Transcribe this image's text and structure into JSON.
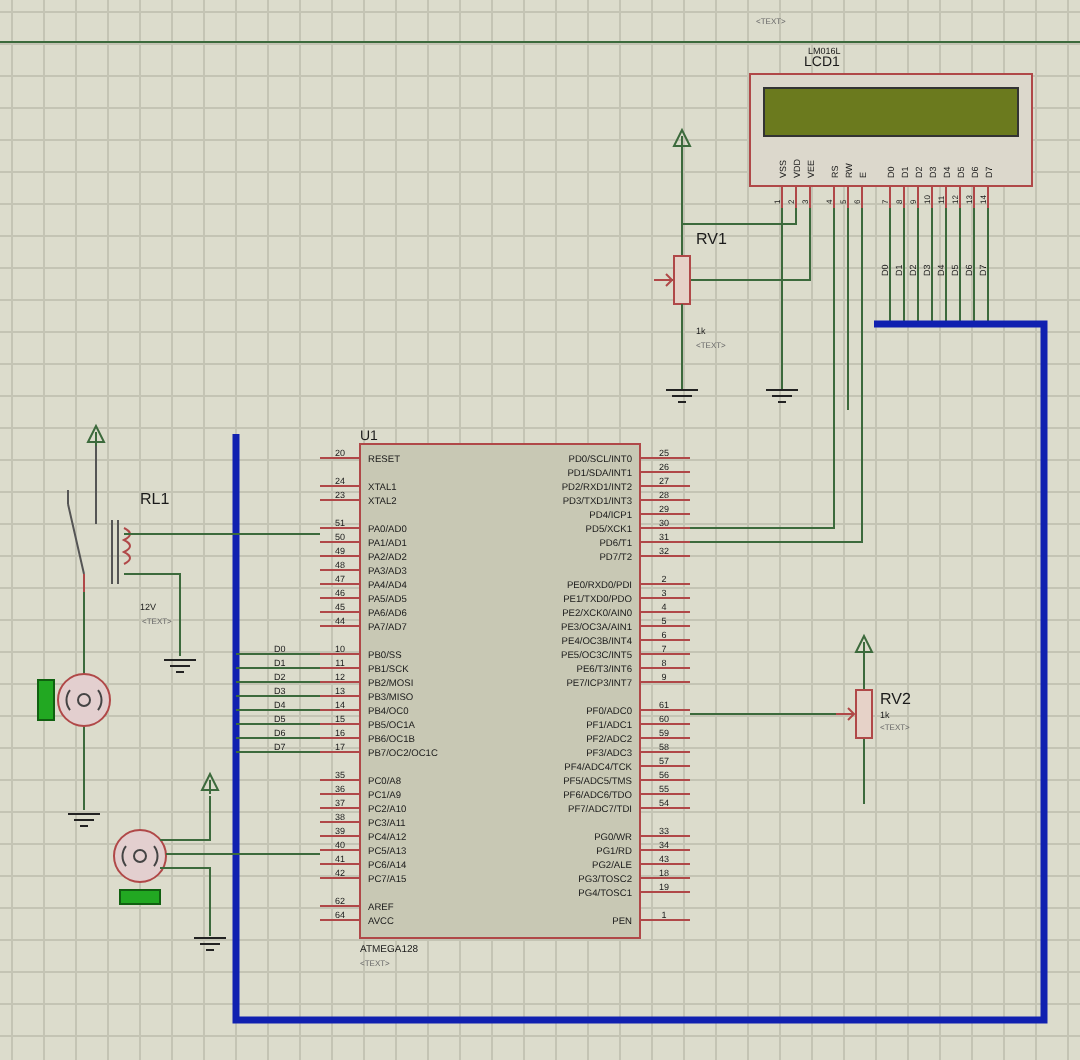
{
  "lcd": {
    "ref": "LCD1",
    "part": "LM016L",
    "text": "<TEXT>",
    "pins": [
      {
        "name": "VSS",
        "number": "1"
      },
      {
        "name": "VDD",
        "number": "2"
      },
      {
        "name": "VEE",
        "number": "3"
      },
      {
        "name": "RS",
        "number": "4"
      },
      {
        "name": "RW",
        "number": "5"
      },
      {
        "name": "E",
        "number": "6"
      },
      {
        "name": "D0",
        "number": "7"
      },
      {
        "name": "D1",
        "number": "8"
      },
      {
        "name": "D2",
        "number": "9"
      },
      {
        "name": "D3",
        "number": "10"
      },
      {
        "name": "D4",
        "number": "11"
      },
      {
        "name": "D5",
        "number": "12"
      },
      {
        "name": "D6",
        "number": "13"
      },
      {
        "name": "D7",
        "number": "14"
      }
    ],
    "bus_labels": [
      "D0",
      "D1",
      "D2",
      "D3",
      "D4",
      "D5",
      "D6",
      "D7"
    ]
  },
  "rv1": {
    "ref": "RV1",
    "value": "1k",
    "text": "<TEXT>"
  },
  "u1": {
    "ref": "U1",
    "part": "ATMEGA128",
    "text": "<TEXT>",
    "left_pins": [
      {
        "name": "RESET",
        "number": "20"
      },
      {
        "name": "XTAL1",
        "number": "24"
      },
      {
        "name": "XTAL2",
        "number": "23"
      },
      {
        "name": "PA0/AD0",
        "number": "51"
      },
      {
        "name": "PA1/AD1",
        "number": "50"
      },
      {
        "name": "PA2/AD2",
        "number": "49"
      },
      {
        "name": "PA3/AD3",
        "number": "48"
      },
      {
        "name": "PA4/AD4",
        "number": "47"
      },
      {
        "name": "PA5/AD5",
        "number": "46"
      },
      {
        "name": "PA6/AD6",
        "number": "45"
      },
      {
        "name": "PA7/AD7",
        "number": "44"
      },
      {
        "name": "PB0/SS",
        "number": "10"
      },
      {
        "name": "PB1/SCK",
        "number": "11"
      },
      {
        "name": "PB2/MOSI",
        "number": "12"
      },
      {
        "name": "PB3/MISO",
        "number": "13"
      },
      {
        "name": "PB4/OC0",
        "number": "14"
      },
      {
        "name": "PB5/OC1A",
        "number": "15"
      },
      {
        "name": "PB6/OC1B",
        "number": "16"
      },
      {
        "name": "PB7/OC2/OC1C",
        "number": "17"
      },
      {
        "name": "PC0/A8",
        "number": "35"
      },
      {
        "name": "PC1/A9",
        "number": "36"
      },
      {
        "name": "PC2/A10",
        "number": "37"
      },
      {
        "name": "PC3/A11",
        "number": "38"
      },
      {
        "name": "PC4/A12",
        "number": "39"
      },
      {
        "name": "PC5/A13",
        "number": "40"
      },
      {
        "name": "PC6/A14",
        "number": "41"
      },
      {
        "name": "PC7/A15",
        "number": "42"
      },
      {
        "name": "AREF",
        "number": "62"
      },
      {
        "name": "AVCC",
        "number": "64"
      }
    ],
    "right_pins": [
      {
        "name": "PD0/SCL/INT0",
        "number": "25"
      },
      {
        "name": "PD1/SDA/INT1",
        "number": "26"
      },
      {
        "name": "PD2/RXD1/INT2",
        "number": "27"
      },
      {
        "name": "PD3/TXD1/INT3",
        "number": "28"
      },
      {
        "name": "PD4/ICP1",
        "number": "29"
      },
      {
        "name": "PD5/XCK1",
        "number": "30"
      },
      {
        "name": "PD6/T1",
        "number": "31"
      },
      {
        "name": "PD7/T2",
        "number": "32"
      },
      {
        "name": "PE0/RXD0/PDI",
        "number": "2"
      },
      {
        "name": "PE1/TXD0/PDO",
        "number": "3"
      },
      {
        "name": "PE2/XCK0/AIN0",
        "number": "4"
      },
      {
        "name": "PE3/OC3A/AIN1",
        "number": "5"
      },
      {
        "name": "PE4/OC3B/INT4",
        "number": "6"
      },
      {
        "name": "PE5/OC3C/INT5",
        "number": "7"
      },
      {
        "name": "PE6/T3/INT6",
        "number": "8"
      },
      {
        "name": "PE7/ICP3/INT7",
        "number": "9"
      },
      {
        "name": "PF0/ADC0",
        "number": "61"
      },
      {
        "name": "PF1/ADC1",
        "number": "60"
      },
      {
        "name": "PF2/ADC2",
        "number": "59"
      },
      {
        "name": "PF3/ADC3",
        "number": "58"
      },
      {
        "name": "PF4/ADC4/TCK",
        "number": "57"
      },
      {
        "name": "PF5/ADC5/TMS",
        "number": "56"
      },
      {
        "name": "PF6/ADC6/TDO",
        "number": "55"
      },
      {
        "name": "PF7/ADC7/TDI",
        "number": "54"
      },
      {
        "name": "PG0/WR",
        "number": "33"
      },
      {
        "name": "PG1/RD",
        "number": "34"
      },
      {
        "name": "PG2/ALE",
        "number": "43"
      },
      {
        "name": "PG3/TOSC2",
        "number": "18"
      },
      {
        "name": "PG4/TOSC1",
        "number": "19"
      },
      {
        "name": "PEN",
        "number": "1"
      }
    ],
    "bus_labels": [
      "D0",
      "D1",
      "D2",
      "D3",
      "D4",
      "D5",
      "D6",
      "D7"
    ]
  },
  "rl1": {
    "ref": "RL1",
    "value": "12V",
    "text": "<TEXT>"
  },
  "rv2": {
    "ref": "RV2",
    "value": "1k",
    "text": "<TEXT>"
  }
}
